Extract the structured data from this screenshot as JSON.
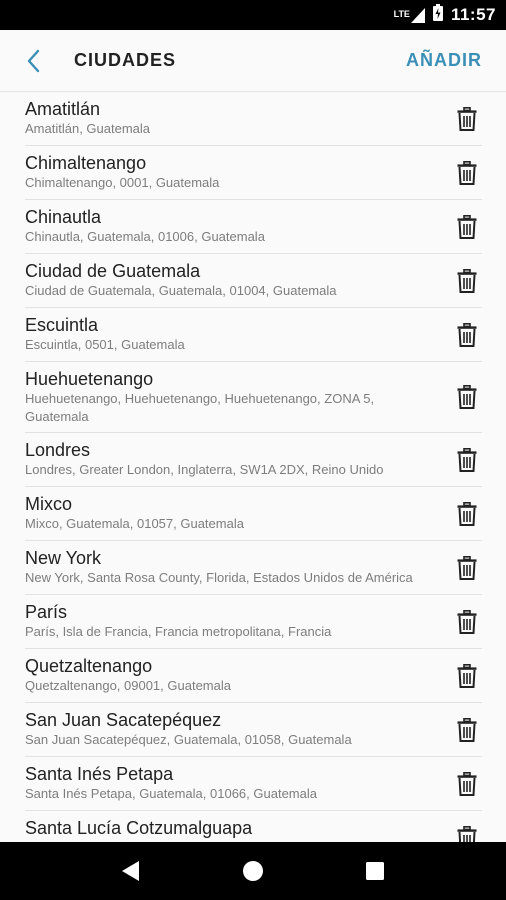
{
  "status_bar": {
    "network": "LTE",
    "time": "11:57"
  },
  "app_bar": {
    "title": "CIUDADES",
    "add_label": "AÑADIR"
  },
  "cities": [
    {
      "name": "Amatitlán",
      "address": "Amatitlán, Guatemala"
    },
    {
      "name": "Chimaltenango",
      "address": "Chimaltenango, 0001, Guatemala"
    },
    {
      "name": "Chinautla",
      "address": "Chinautla, Guatemala, 01006, Guatemala"
    },
    {
      "name": "Ciudad de Guatemala",
      "address": "Ciudad de Guatemala, Guatemala, 01004, Guatemala"
    },
    {
      "name": "Escuintla",
      "address": "Escuintla, 0501, Guatemala"
    },
    {
      "name": "Huehuetenango",
      "address": "Huehuetenango, Huehuetenango, Huehuetenango, ZONA 5, Guatemala"
    },
    {
      "name": "Londres",
      "address": "Londres, Greater London, Inglaterra, SW1A 2DX, Reino Unido"
    },
    {
      "name": "Mixco",
      "address": "Mixco, Guatemala, 01057, Guatemala"
    },
    {
      "name": "New York",
      "address": "New York, Santa Rosa County, Florida, Estados Unidos de América"
    },
    {
      "name": "París",
      "address": "París, Isla de Francia, Francia metropolitana, Francia"
    },
    {
      "name": "Quetzaltenango",
      "address": "Quetzaltenango, 09001, Guatemala"
    },
    {
      "name": "San Juan Sacatepéquez",
      "address": "San Juan Sacatepéquez, Guatemala, 01058, Guatemala"
    },
    {
      "name": "Santa Inés Petapa",
      "address": "Santa Inés Petapa, Guatemala, 01066, Guatemala"
    },
    {
      "name": "Santa Lucía Cotzumalguapa",
      "address": ""
    }
  ],
  "colors": {
    "accent": "#3a8fb7",
    "text": "#222222",
    "secondary_text": "#7d7d7d"
  }
}
